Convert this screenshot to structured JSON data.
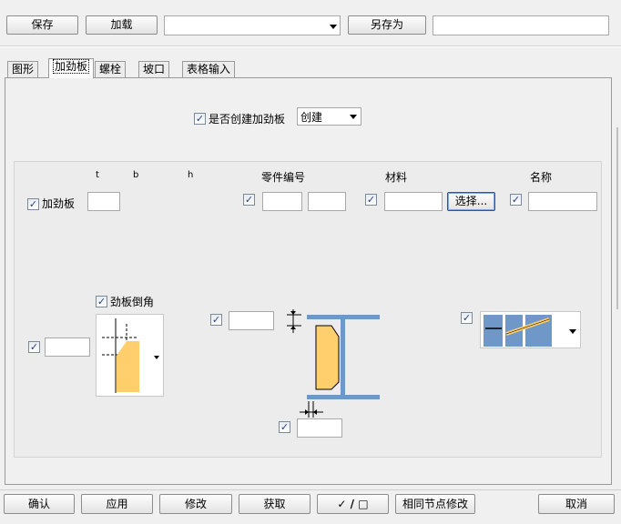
{
  "toolbar": {
    "save_label": "保存",
    "load_label": "加载",
    "preset_value": "",
    "save_as_label": "另存为",
    "save_as_name": ""
  },
  "tabs": [
    {
      "label": "图形"
    },
    {
      "label": "加劲板"
    },
    {
      "label": "螺栓"
    },
    {
      "label": "坡口"
    },
    {
      "label": "表格输入"
    }
  ],
  "create": {
    "checkbox_label": "是否创建加劲板",
    "checked": true,
    "select_value": "创建"
  },
  "columns": {
    "t": "t",
    "b": "b",
    "h": "h",
    "part_number": "零件编号",
    "material": "材料",
    "name": "名称"
  },
  "stiffener": {
    "label": "加劲板",
    "t_value": "",
    "part_prefix": "",
    "part_start": "",
    "material_value": "",
    "select_button": "选择...",
    "name_value": ""
  },
  "chamfer": {
    "label": "劲板倒角",
    "value": ""
  },
  "gap_values": {
    "top": "",
    "bottom": ""
  },
  "bottom_bar": {
    "ok": "确认",
    "apply": "应用",
    "modify": "修改",
    "get": "获取",
    "toggle": "✓ / □",
    "same_node_modify": "相同节点修改",
    "cancel": "取消"
  },
  "colors": {
    "steel_blue": "#6f97c7",
    "plate_yellow": "#ffcf6e"
  }
}
